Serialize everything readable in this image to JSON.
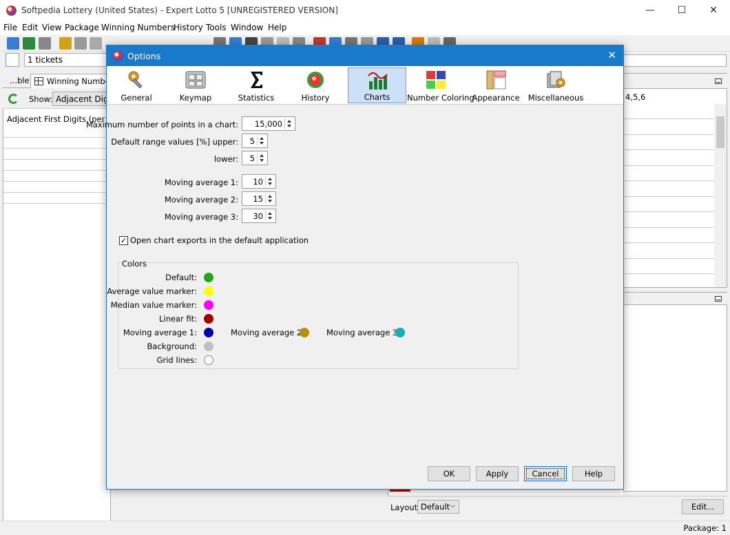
{
  "window": {
    "title": "Softpedia Lottery (United States) - Expert Lotto 5 [UNREGISTERED VERSION]",
    "controls": {
      "minimize": "—",
      "maximize": "☐",
      "close": "✕"
    }
  },
  "menu": [
    "File",
    "Edit",
    "View",
    "Package",
    "Winning Numbers",
    "History",
    "Tools",
    "Window",
    "Help"
  ],
  "ticketbar": {
    "tickets": "1 tickets"
  },
  "left_panel": {
    "tab_prev": "...ble",
    "tab_active": "Winning Numbers",
    "show_label": "Show:",
    "show_value": "Adjacent Digits",
    "row_text": "Adjacent First Digits (per ticket"
  },
  "right_panel": {
    "text": "4,5,6"
  },
  "bottom": {
    "layout_label": "Layout:",
    "layout_value": "Default",
    "edit_label": "Edit...",
    "status": "Package: 1"
  },
  "dialog": {
    "title": "Options",
    "close": "✕",
    "categories": [
      {
        "label": "General",
        "icon": "gear-wrench-icon"
      },
      {
        "label": "Keymap",
        "icon": "keyboard-icon"
      },
      {
        "label": "Statistics",
        "icon": "sigma-icon"
      },
      {
        "label": "History",
        "icon": "history-icon"
      },
      {
        "label": "Charts",
        "icon": "bar-chart-icon",
        "selected": true
      },
      {
        "label": "Number Coloring",
        "icon": "color-grid-icon"
      },
      {
        "label": "Appearance",
        "icon": "appearance-icon"
      },
      {
        "label": "Miscellaneous",
        "icon": "misc-icon"
      }
    ],
    "fields": {
      "max_points_label": "Maximum number of points in a chart:",
      "max_points_value": "15,000",
      "range_upper_label": "Default range values [%] upper:",
      "range_upper_value": "5",
      "range_lower_label": "lower:",
      "range_lower_value": "5",
      "ma1_label": "Moving average 1:",
      "ma1_value": "10",
      "ma2_label": "Moving average 2:",
      "ma2_value": "15",
      "ma3_label": "Moving average 3:",
      "ma3_value": "30"
    },
    "checkbox": {
      "label": "Open chart exports in the default application",
      "checked": true
    },
    "colors": {
      "title": "Colors",
      "items": [
        {
          "label": "Default:",
          "color": "#1fa61f"
        },
        {
          "label": "Average value marker:",
          "color": "#ffff00"
        },
        {
          "label": "Median value marker:",
          "color": "#ff00ff"
        },
        {
          "label": "Linear fit:",
          "color": "#a00000"
        },
        {
          "label": "Moving average 1:",
          "color": "#0000a8"
        },
        {
          "label": "Moving average 2:",
          "color": "#b8900a"
        },
        {
          "label": "Moving average 3:",
          "color": "#12b0b0"
        },
        {
          "label": "Background:",
          "color": "#c0c0c0"
        },
        {
          "label": "Grid lines:",
          "color": "#ffffff"
        }
      ]
    },
    "buttons": {
      "ok": "OK",
      "apply": "Apply",
      "cancel": "Cancel",
      "help": "Help"
    }
  }
}
